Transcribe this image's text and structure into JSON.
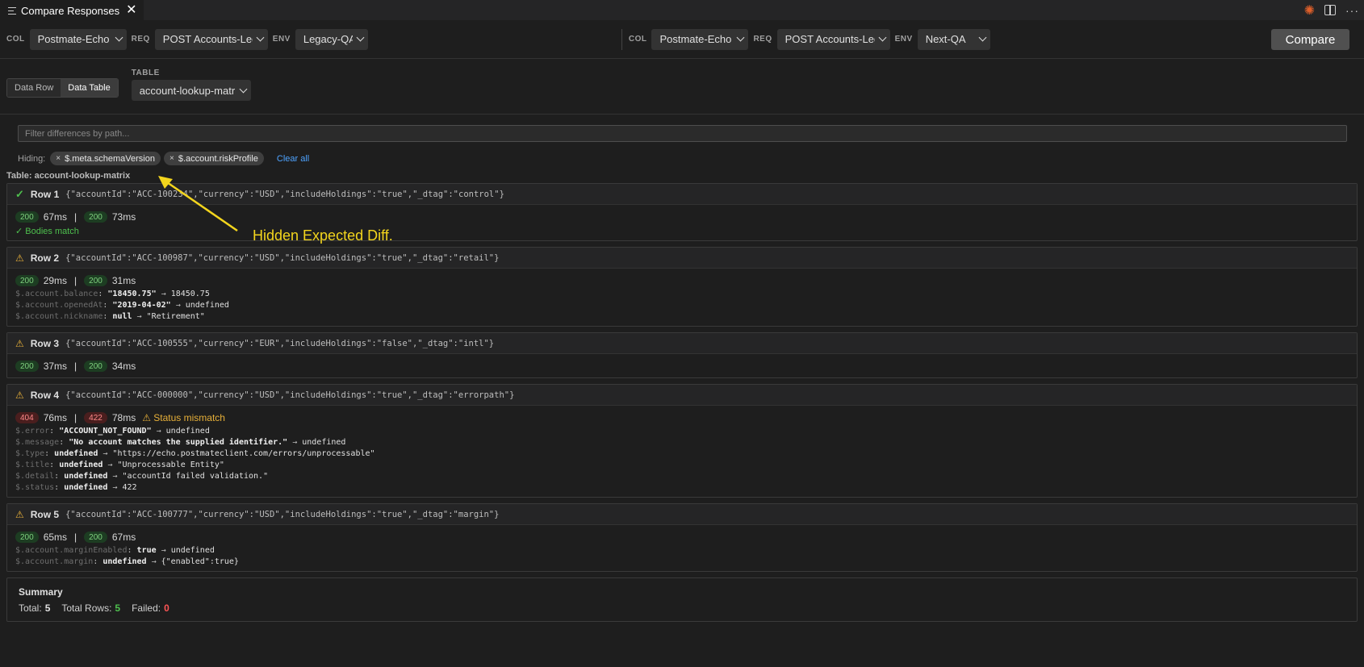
{
  "tab": {
    "title": "Compare Responses"
  },
  "icons": {
    "menu": "menu-icon",
    "close": "close-icon",
    "spark": "sparkle-icon",
    "split": "split-editor-icon",
    "more": "more-icon"
  },
  "left": {
    "col_label": "COL",
    "col": "Postmate-Echo",
    "req_label": "REQ",
    "req": "POST Accounts-Legacy-",
    "env_label": "ENV",
    "env": "Legacy-QA"
  },
  "right": {
    "col_label": "COL",
    "col": "Postmate-Echo",
    "req_label": "REQ",
    "req": "POST Accounts-Legacy-",
    "env_label": "ENV",
    "env": "Next-QA"
  },
  "compare_label": "Compare",
  "mode": {
    "data_row": "Data Row",
    "data_table": "Data Table",
    "active": "Data Table"
  },
  "table": {
    "label": "TABLE",
    "value": "account-lookup-matrix"
  },
  "filter": {
    "placeholder": "Filter differences by path..."
  },
  "hiding": {
    "label": "Hiding:",
    "chips": [
      "$.meta.schemaVersion",
      "$.account.riskProfile"
    ],
    "clear": "Clear all"
  },
  "table_title": "Table: account-lookup-matrix",
  "annotation": "Hidden Expected Diff.",
  "colors": {
    "ok": "#4ec04e",
    "warn": "#e7b039",
    "annotation": "#f3d51d",
    "fail": "#ff5555"
  },
  "rows": [
    {
      "label": "Row 1",
      "params": "{\"accountId\":\"ACC-100234\",\"currency\":\"USD\",\"includeHoldings\":\"true\",\"_dtag\":\"control\"}",
      "status_icon": "check-icon",
      "a_code": "200",
      "a_time": "67ms",
      "b_code": "200",
      "b_time": "73ms",
      "match": "✓ Bodies match"
    },
    {
      "label": "Row 2",
      "params": "{\"accountId\":\"ACC-100987\",\"currency\":\"USD\",\"includeHoldings\":\"true\",\"_dtag\":\"retail\"}",
      "status_icon": "warning-icon",
      "a_code": "200",
      "a_time": "29ms",
      "b_code": "200",
      "b_time": "31ms",
      "diffs": [
        {
          "path": "$.account.balance",
          "old": "\"18450.75\"",
          "new": "18450.75"
        },
        {
          "path": "$.account.openedAt",
          "old": "\"2019-04-02\"",
          "new": "undefined"
        },
        {
          "path": "$.account.nickname",
          "old": "null",
          "new": "\"Retirement\""
        }
      ]
    },
    {
      "label": "Row 3",
      "params": "{\"accountId\":\"ACC-100555\",\"currency\":\"EUR\",\"includeHoldings\":\"false\",\"_dtag\":\"intl\"}",
      "status_icon": "warning-icon",
      "a_code": "200",
      "a_time": "37ms",
      "b_code": "200",
      "b_time": "34ms"
    },
    {
      "label": "Row 4",
      "params": "{\"accountId\":\"ACC-000000\",\"currency\":\"USD\",\"includeHoldings\":\"true\",\"_dtag\":\"errorpath\"}",
      "status_icon": "warning-icon",
      "a_code": "404",
      "a_time": "76ms",
      "b_code": "422",
      "b_time": "78ms",
      "mismatch": "⚠ Status mismatch",
      "diffs": [
        {
          "path": "$.error",
          "old": "\"ACCOUNT_NOT_FOUND\"",
          "new": "undefined"
        },
        {
          "path": "$.message",
          "old": "\"No account matches the supplied identifier.\"",
          "new": "undefined"
        },
        {
          "path": "$.type",
          "old": "undefined",
          "new": "\"https://echo.postmateclient.com/errors/unprocessable\""
        },
        {
          "path": "$.title",
          "old": "undefined",
          "new": "\"Unprocessable Entity\""
        },
        {
          "path": "$.detail",
          "old": "undefined",
          "new": "\"accountId failed validation.\""
        },
        {
          "path": "$.status",
          "old": "undefined",
          "new": "422"
        }
      ]
    },
    {
      "label": "Row 5",
      "params": "{\"accountId\":\"ACC-100777\",\"currency\":\"USD\",\"includeHoldings\":\"true\",\"_dtag\":\"margin\"}",
      "status_icon": "warning-icon",
      "a_code": "200",
      "a_time": "65ms",
      "b_code": "200",
      "b_time": "67ms",
      "diffs": [
        {
          "path": "$.account.marginEnabled",
          "old": "true",
          "new": "undefined"
        },
        {
          "path": "$.account.margin",
          "old": "undefined",
          "new": "{\"enabled\":true}"
        }
      ]
    }
  ],
  "summary": {
    "title": "Summary",
    "total_label": "Total:",
    "total": "5",
    "rows_label": "Total Rows:",
    "rows": "5",
    "failed_label": "Failed:",
    "failed": "0"
  }
}
